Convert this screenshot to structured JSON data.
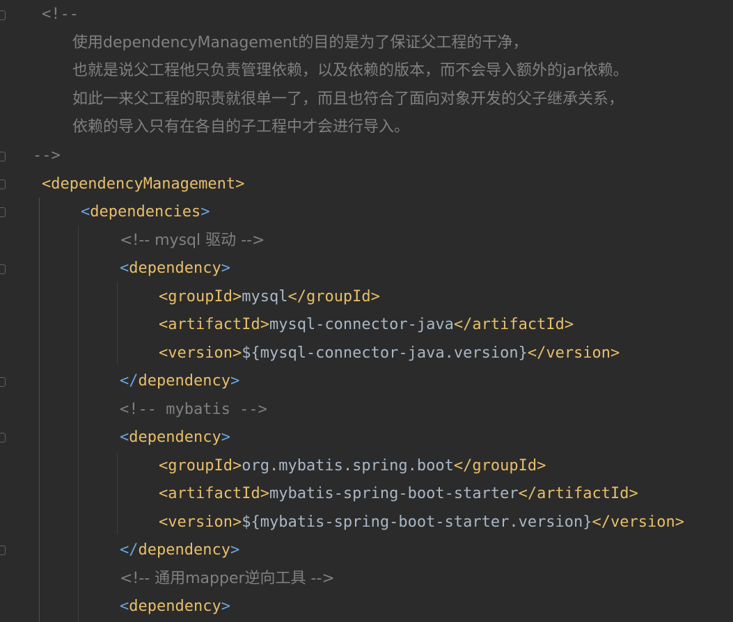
{
  "editor": {
    "comment_open": "<!--",
    "comment_lines": [
      "使用dependencyManagement的目的是为了保证父工程的干净，",
      "也就是说父工程他只负责管理依赖，以及依赖的版本，而不会导入额外的jar依赖。",
      "如此一来父工程的职责就很单一了，而且也符合了面向对象开发的父子继承关系，",
      "依赖的导入只有在各自的子工程中才会进行导入。"
    ],
    "comment_close": "-->",
    "root_tag": "dependencyManagement",
    "deps_tag": "dependencies",
    "dependency_tag": "dependency",
    "group_tag": "groupId",
    "artifact_tag": "artifactId",
    "version_tag": "version",
    "blocks": [
      {
        "comment": "<!-- mysql 驱动 -->",
        "groupId": "mysql",
        "artifactId": "mysql-connector-java",
        "version": "${mysql-connector-java.version}"
      },
      {
        "comment": "<!-- mybatis -->",
        "groupId": "org.mybatis.spring.boot",
        "artifactId": "mybatis-spring-boot-starter",
        "version": "${mybatis-spring-boot-starter.version}"
      },
      {
        "comment": "<!-- 通用mapper逆向工具 -->"
      }
    ],
    "colors": {
      "background": "#2b2b2b",
      "tag": "#e8bf6a",
      "dependencies_tag": "#6aa6e0",
      "text": "#a9b7c6",
      "comment": "#808080",
      "bracket": "#e8bf6a"
    }
  }
}
